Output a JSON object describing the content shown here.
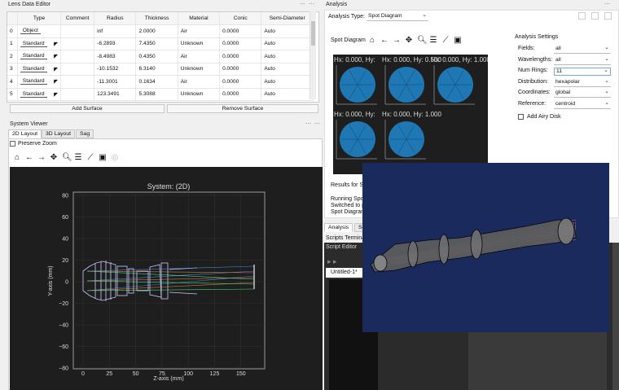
{
  "lens_editor": {
    "title": "Lens Data Editor",
    "columns": [
      "",
      "Type",
      "Comment",
      "Radius",
      "Thickness",
      "Material",
      "Conic",
      "Semi-Diameter"
    ],
    "rows": [
      {
        "i": "0",
        "type": "Object",
        "comment": "",
        "radius": "inf",
        "thickness": "2.0000",
        "material": "Air",
        "conic": "0.0000",
        "semi": "Auto"
      },
      {
        "i": "1",
        "type": "Standard",
        "comment": "",
        "radius": "-6.2893",
        "thickness": "7.4350",
        "material": "Unknown",
        "conic": "0.0000",
        "semi": "Auto"
      },
      {
        "i": "2",
        "type": "Standard",
        "comment": "",
        "radius": "-8.4983",
        "thickness": "0.4350",
        "material": "Air",
        "conic": "0.0000",
        "semi": "Auto"
      },
      {
        "i": "3",
        "type": "Standard",
        "comment": "",
        "radius": "-10.1532",
        "thickness": "6.3140",
        "material": "Unknown",
        "conic": "0.0000",
        "semi": "Auto"
      },
      {
        "i": "4",
        "type": "Standard",
        "comment": "",
        "radius": "-11.3001",
        "thickness": "0.1634",
        "material": "Air",
        "conic": "0.0000",
        "semi": "Auto"
      },
      {
        "i": "5",
        "type": "Standard",
        "comment": "",
        "radius": "123.3491",
        "thickness": "5.3088",
        "material": "Unknown",
        "conic": "0.0000",
        "semi": "Auto"
      }
    ],
    "add_surface": "Add Surface",
    "remove_surface": "Remove Surface"
  },
  "system_viewer": {
    "title": "System Viewer",
    "tabs": [
      "2D Layout",
      "3D Layout",
      "Sag"
    ],
    "preserve_zoom": "Preserve Zoom"
  },
  "plot2d": {
    "title": "System:  (2D)",
    "xlabel": "Z-axis (mm)",
    "ylabel": "Y-axis (mm)",
    "yticks": [
      "80",
      "60",
      "40",
      "20",
      "0",
      "−20",
      "−40",
      "−60",
      "−80"
    ],
    "xticks": [
      "0",
      "25",
      "50",
      "75",
      "100",
      "125",
      "150"
    ]
  },
  "analysis": {
    "title": "Analysis",
    "type_label": "Analysis Type:",
    "type_value": "Spot Diagram",
    "spot_title": "Spot Diagram",
    "spot_labels": [
      "Hx: 0.000, Hy:",
      "Hx: 0.000, Hy: 0.500",
      "Hx: 0.000, Hy: 1.000"
    ],
    "spot_labels2": [
      "Hx: 0.000, Hy:",
      "Hx: 0.000, Hy: 1.000"
    ],
    "results_label": "Results for Spo",
    "log": [
      "Running Spot",
      "Switched to p",
      "Spot Diagram"
    ],
    "settings_title": "Analysis Settings",
    "settings": [
      {
        "label": "Fields:",
        "value": "all"
      },
      {
        "label": "Wavelengths:",
        "value": "all"
      },
      {
        "label": "Num Rings:",
        "value": "11"
      },
      {
        "label": "Distribution:",
        "value": "hexapolar"
      },
      {
        "label": "Coordinates:",
        "value": "global"
      },
      {
        "label": "Reference:",
        "value": "centroid"
      }
    ],
    "airy": "Add Airy Disk"
  },
  "bottom": {
    "tabs": [
      "Analysis",
      "Sc"
    ],
    "scripts_terminal": "Scripts Termina",
    "script_editor": "Script Editor",
    "file": "Untitled-1*"
  },
  "colors": {
    "spot": "#1f77b4",
    "dark": "#1e1e1e",
    "navy": "#1b2a5c"
  }
}
